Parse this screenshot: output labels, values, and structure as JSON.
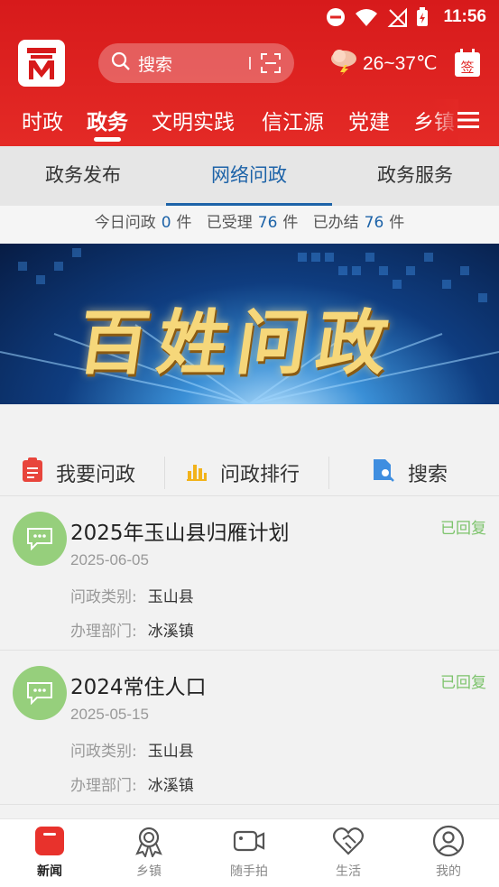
{
  "status_bar": {
    "time": "11:56"
  },
  "header": {
    "search": {
      "placeholder": "搜索"
    },
    "weather": {
      "temperature": "26~37℃"
    },
    "calendar_label": "签",
    "channels": [
      {
        "label": "时政",
        "active": false
      },
      {
        "label": "政务",
        "active": true
      },
      {
        "label": "文明实践",
        "active": false
      },
      {
        "label": "信江源",
        "active": false
      },
      {
        "label": "党建",
        "active": false
      },
      {
        "label": "乡镇",
        "active": false
      }
    ]
  },
  "subtabs": [
    {
      "label": "政务发布",
      "active": false
    },
    {
      "label": "网络问政",
      "active": true
    },
    {
      "label": "政务服务",
      "active": false
    }
  ],
  "stats": {
    "today_label": "今日问政",
    "today_value": "0",
    "unit": "件",
    "accepted_label": "已受理",
    "accepted_value": "76",
    "done_label": "已办结",
    "done_value": "76"
  },
  "banner": {
    "title": "百姓问政"
  },
  "actions": [
    {
      "label": "我要问政",
      "icon": "clipboard-icon"
    },
    {
      "label": "问政排行",
      "icon": "bar-chart-icon"
    },
    {
      "label": "搜索",
      "icon": "search-doc-icon"
    }
  ],
  "items": [
    {
      "title": "2025年玉山县归雁计划",
      "status": "已回复",
      "date": "2025-06-05",
      "category_label": "问政类别:",
      "category": "玉山县",
      "dept_label": "办理部门:",
      "dept": "冰溪镇"
    },
    {
      "title": "2024常住人口",
      "status": "已回复",
      "date": "2025-05-15",
      "category_label": "问政类别:",
      "category": "玉山县",
      "dept_label": "办理部门:",
      "dept": "冰溪镇"
    }
  ],
  "bottom_nav": [
    {
      "label": "新闻",
      "active": true
    },
    {
      "label": "乡镇",
      "active": false
    },
    {
      "label": "随手拍",
      "active": false
    },
    {
      "label": "生活",
      "active": false
    },
    {
      "label": "我的",
      "active": false
    }
  ],
  "colors": {
    "header_red": "#e02624",
    "accent_blue": "#1d63a8",
    "status_green": "#7cc36b"
  }
}
